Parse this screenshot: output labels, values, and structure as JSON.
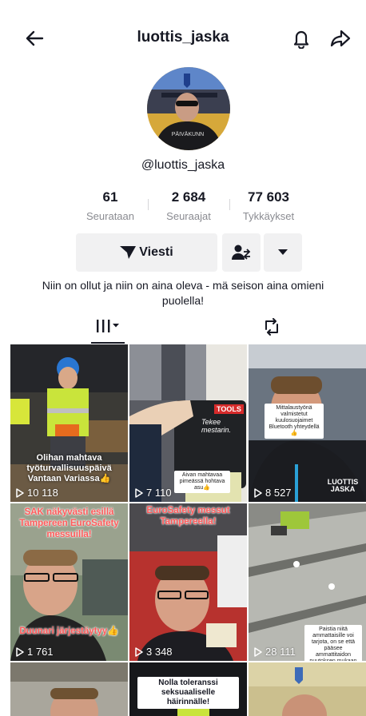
{
  "header": {
    "title": "luottis_jaska",
    "back_icon": "back-arrow-icon",
    "bell_icon": "bell-icon",
    "share_icon": "share-icon"
  },
  "profile": {
    "handle": "@luottis_jaska",
    "stats": [
      {
        "value": "61",
        "label": "Seurataan"
      },
      {
        "value": "2 684",
        "label": "Seuraajat"
      },
      {
        "value": "77 603",
        "label": "Tykkäykset"
      }
    ],
    "message_button": "Viesti",
    "bio": "Niin on ollut ja niin on aina oleva - mä seison aina omieni puolella!"
  },
  "tabs": {
    "videos_icon": "grid-icon",
    "reposts_icon": "repost-icon"
  },
  "videos": [
    {
      "views": "10 118",
      "caption": "Olihan mahtava työturvallisuuspäivä Vantaan Variassa👍"
    },
    {
      "views": "7 110",
      "caption": "Aivan mahtavaa pimeässä hohtava asu👍",
      "sign_a": "TOOLS",
      "sign_b": "Tekee mestarin."
    },
    {
      "views": "8 527",
      "caption": "Mittalaustyönä valmistetut kuulosuojaimet Bluetooth yhteydellä👍",
      "logo": "LUOTTIS JASKA"
    },
    {
      "views": "1 761",
      "caption": "SAK näkyvästi esillä Tampereen EuroSafety messuilla!",
      "caption2": "Duunari järjestäytyy👍"
    },
    {
      "views": "3 348",
      "caption": "EuroSafety messut Tampereella!"
    },
    {
      "views": "28 111",
      "caption": "Paistia niitä ammattaisille voi tarjota, on se että pääsee ammattitaidon puutoksen mukaan👍"
    },
    {
      "views": "",
      "caption": ""
    },
    {
      "views": "",
      "caption": "Nolla toleranssi seksuaaliselle häirinnälle!"
    },
    {
      "views": "",
      "caption": ""
    }
  ]
}
